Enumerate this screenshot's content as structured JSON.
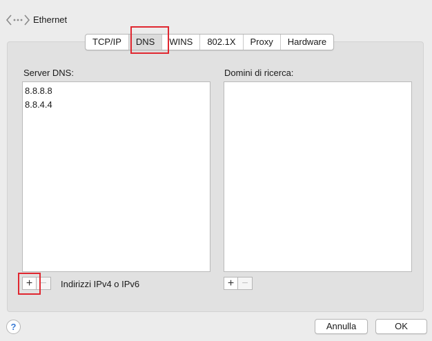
{
  "header": {
    "title": "Ethernet",
    "icon": "network-icon"
  },
  "tabs": [
    {
      "label": "TCP/IP",
      "selected": false
    },
    {
      "label": "DNS",
      "selected": true
    },
    {
      "label": "WINS",
      "selected": false
    },
    {
      "label": "802.1X",
      "selected": false
    },
    {
      "label": "Proxy",
      "selected": false
    },
    {
      "label": "Hardware",
      "selected": false
    }
  ],
  "dns": {
    "label": "Server DNS:",
    "servers": [
      "8.8.8.8",
      "8.8.4.4"
    ],
    "add": "+",
    "remove": "−",
    "hint": "Indirizzi IPv4 o IPv6"
  },
  "search_domains": {
    "label": "Domini di ricerca:",
    "items": [],
    "add": "+",
    "remove": "−"
  },
  "footer": {
    "help": "?",
    "cancel": "Annulla",
    "ok": "OK"
  },
  "colors": {
    "highlight": "#e0262f",
    "panel": "#e1e1e1",
    "background": "#ececec"
  }
}
